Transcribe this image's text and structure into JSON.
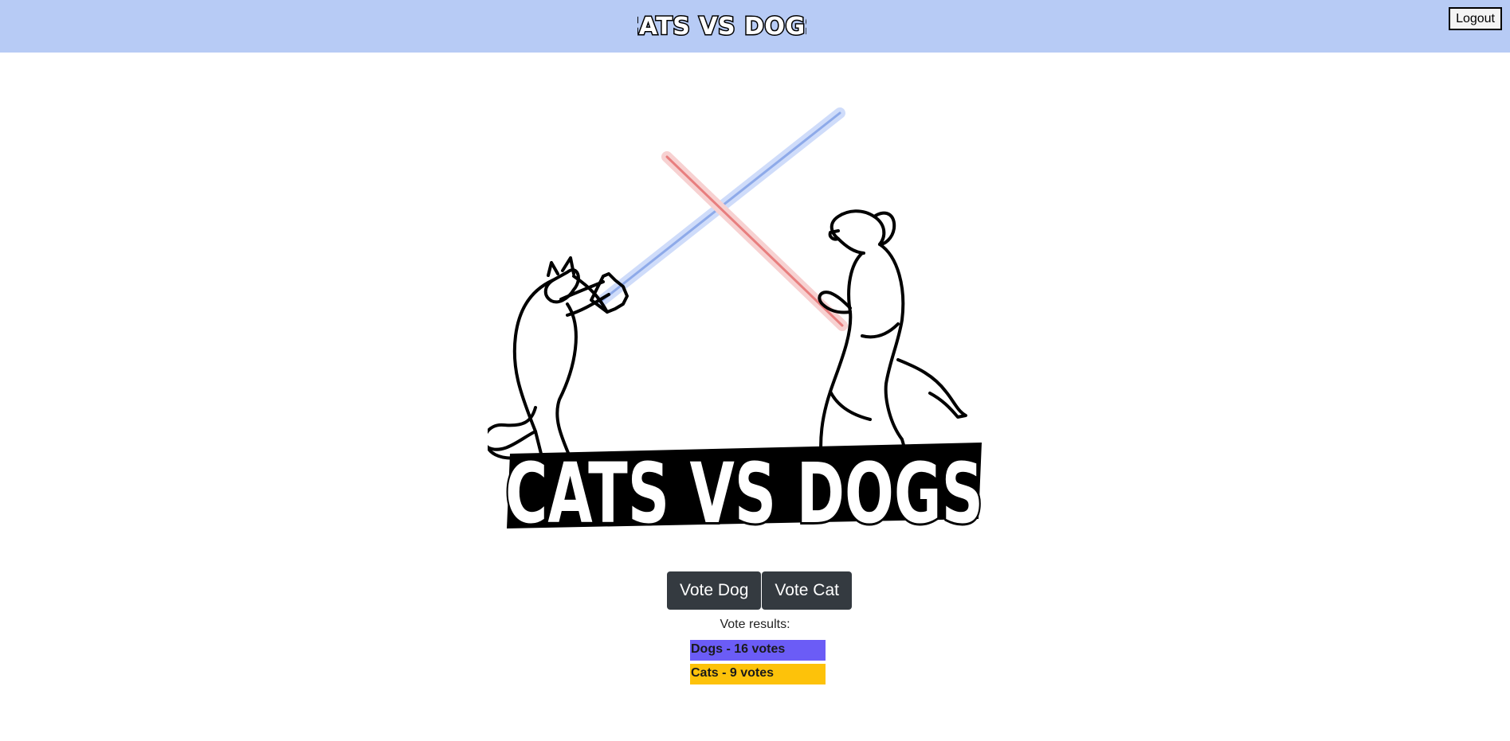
{
  "header": {
    "brand": "CATS VS DOGS",
    "logout_label": "Logout"
  },
  "hero": {
    "banner_text": "CATS VS DOGS"
  },
  "vote": {
    "dog_label": "Vote Dog",
    "cat_label": "Vote Cat"
  },
  "results": {
    "label": "Vote results:",
    "items": [
      {
        "text": "Dogs - 16 votes",
        "color": "#6b5cf6"
      },
      {
        "text": "Cats - 9 votes",
        "color": "#fdc20a"
      }
    ]
  },
  "colors": {
    "header_bg": "#b7cbf5",
    "button_bg": "#343a40",
    "red_saber": "#e66",
    "blue_saber": "#6a8fe0"
  }
}
